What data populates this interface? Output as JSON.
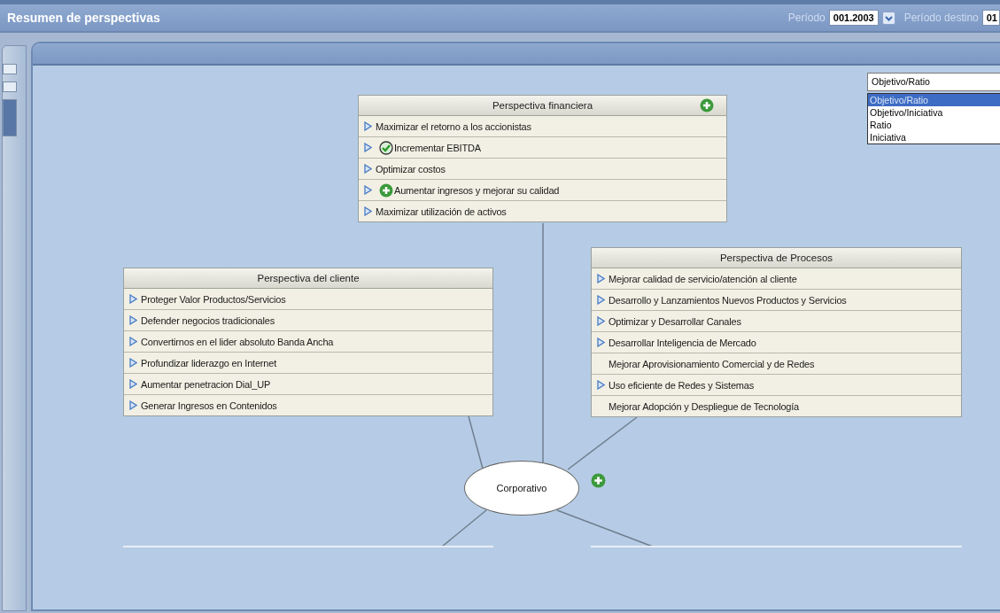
{
  "header": {
    "title": "Resumen de perspectivas",
    "period_label": "Período",
    "period_value": "001.2003",
    "target_label": "Período destino",
    "target_value": "01"
  },
  "view_select": {
    "value": "Objetivo/Ratio",
    "expanded": true,
    "options": [
      {
        "label": "Objetivo/Ratio",
        "selected": true
      },
      {
        "label": "Objetivo/Iniciativa",
        "selected": false
      },
      {
        "label": "Ratio",
        "selected": false
      },
      {
        "label": "Iniciativa",
        "selected": false
      }
    ]
  },
  "perspectives": [
    {
      "title": "Perspectiva financiera",
      "add_icon": true,
      "items": [
        {
          "label": "Maximizar el retorno a los accionistas",
          "expandable": true
        },
        {
          "label": "Incrementar EBITDA",
          "expandable": true,
          "kind": "check"
        },
        {
          "label": "Optimizar costos",
          "expandable": true
        },
        {
          "label": "Aumentar ingresos y mejorar su calidad",
          "expandable": true,
          "kind": "plus"
        },
        {
          "label": "Maximizar utilización de activos",
          "expandable": true
        }
      ]
    },
    {
      "title": "Perspectiva del cliente",
      "add_icon": false,
      "items": [
        {
          "label": "Proteger Valor Productos/Servicios",
          "expandable": true
        },
        {
          "label": "Defender negocios tradicionales",
          "expandable": true
        },
        {
          "label": "Convertirnos en el lider absoluto Banda Ancha",
          "expandable": true
        },
        {
          "label": "Profundizar liderazgo en Internet",
          "expandable": true
        },
        {
          "label": "Aumentar penetracion Dial_UP",
          "expandable": true
        },
        {
          "label": "Generar Ingresos en Contenidos",
          "expandable": true
        }
      ]
    },
    {
      "title": "Perspectiva de Procesos",
      "add_icon": false,
      "items": [
        {
          "label": "Mejorar calidad de servicio/atención al cliente",
          "expandable": true
        },
        {
          "label": "Desarrollo y Lanzamientos Nuevos Productos y Servicios",
          "expandable": true
        },
        {
          "label": "Optimizar y Desarrollar Canales",
          "expandable": true
        },
        {
          "label": "Desarrollar Inteligencia de Mercado",
          "expandable": true
        },
        {
          "label": "Mejorar Aprovisionamiento Comercial y de Redes",
          "expandable": false
        },
        {
          "label": "Uso eficiente de Redes y Sistemas",
          "expandable": true
        },
        {
          "label": "Mejorar Adopción y Despliegue de Tecnología",
          "expandable": false
        }
      ]
    }
  ],
  "center_node": {
    "label": "Corporativo",
    "add_icon": true
  }
}
